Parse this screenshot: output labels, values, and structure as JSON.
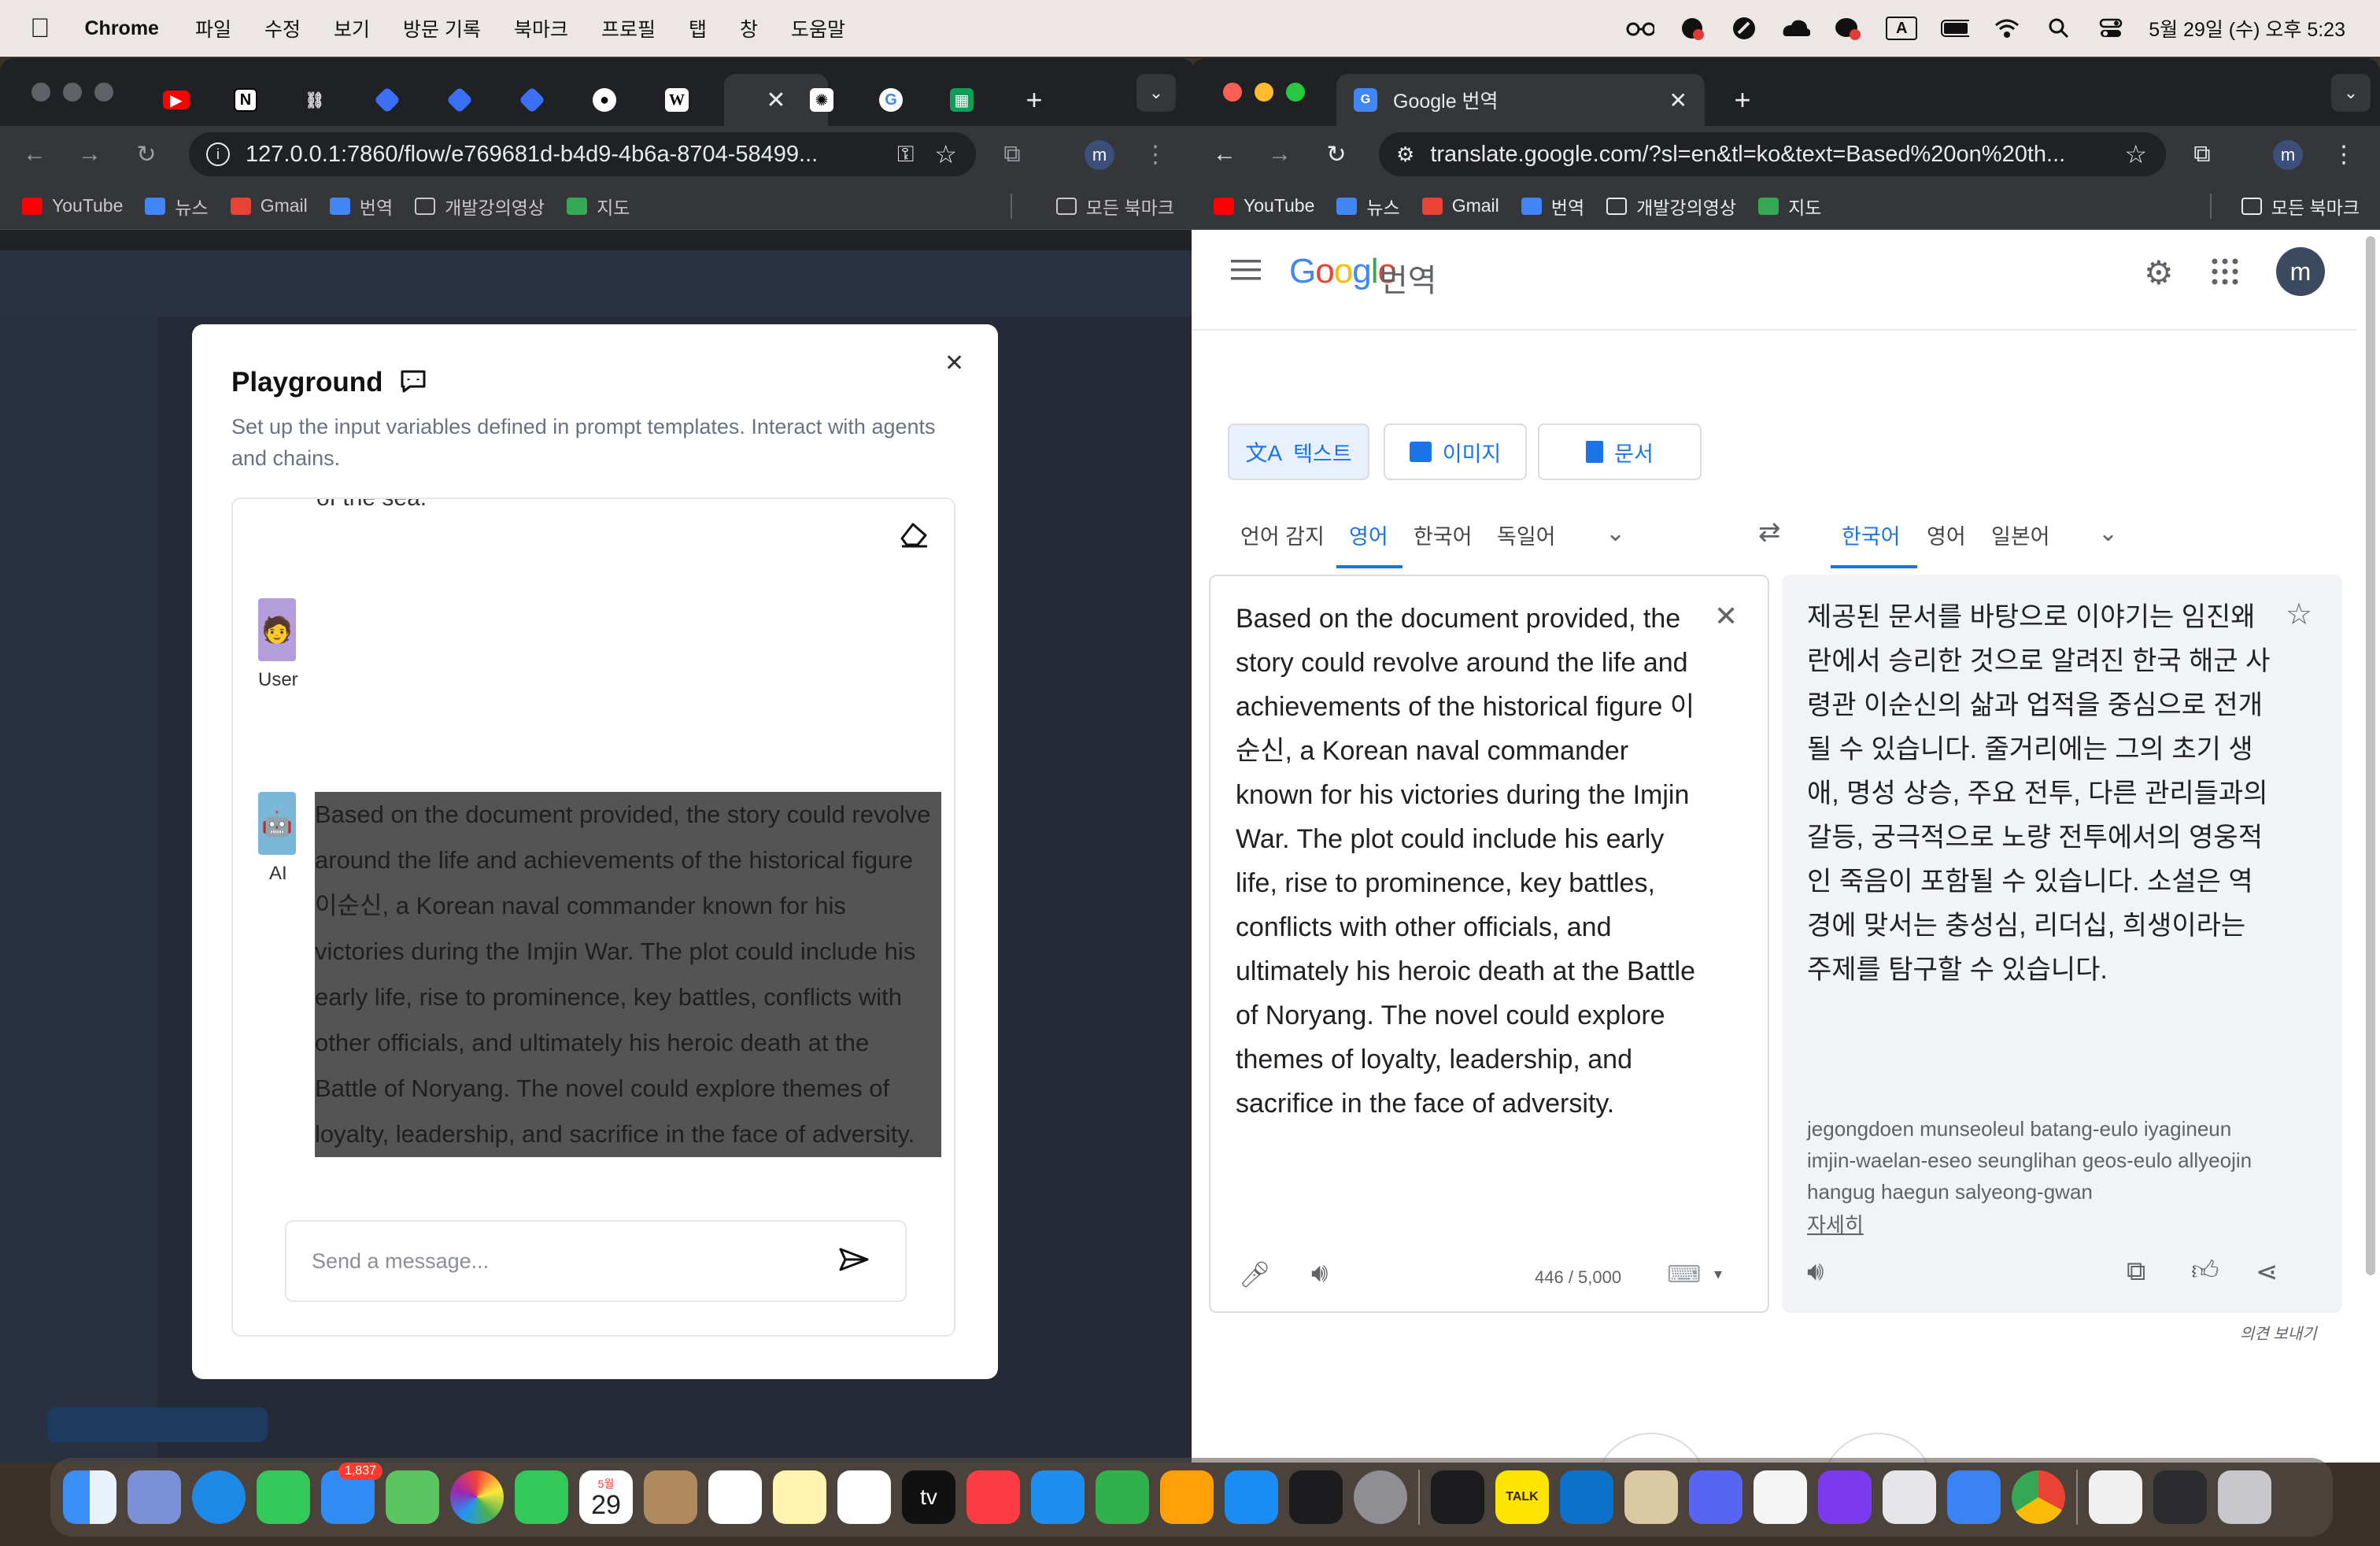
{
  "menubar": {
    "app": "Chrome",
    "items": [
      "파일",
      "수정",
      "보기",
      "방문 기록",
      "북마크",
      "프로필",
      "탭",
      "창",
      "도움말"
    ],
    "clock": "5월 29일 (수) 오후 5:23",
    "input_indicator": "A"
  },
  "left_window": {
    "url": "127.0.0.1:7860/flow/e769681d-b4d9-4b6a-8704-58499...",
    "profile_initial": "m",
    "bookmarks": [
      "YouTube",
      "뉴스",
      "Gmail",
      "번역",
      "개발강의영상",
      "지도"
    ],
    "all_bookmarks": "모든 북마크",
    "playground": {
      "title": "Playground",
      "description": "Set up the input variables defined in prompt templates. Interact with agents and chains.",
      "cut_text": "of the sea.",
      "user_label": "User",
      "ai_label": "AI",
      "ai_message": "Based on the document provided, the story could revolve around the life and achievements of the historical figure 이순신, a Korean naval commander known for his victories during the Imjin War. The plot could include his early life, rise to prominence, key battles, conflicts with other officials, and ultimately his heroic death at the Battle of Noryang. The novel could explore themes of loyalty, leadership, and sacrifice in the face of adversity.",
      "input_placeholder": "Send a message..."
    }
  },
  "right_window": {
    "tab_title": "Google 번역",
    "url": "translate.google.com/?sl=en&tl=ko&text=Based%20on%20th...",
    "profile_initial": "m",
    "bookmarks": [
      "YouTube",
      "뉴스",
      "Gmail",
      "번역",
      "개발강의영상",
      "지도"
    ],
    "all_bookmarks": "모든 북마크",
    "translate": {
      "product": "번역",
      "account_initial": "m",
      "modes": [
        "텍스트",
        "이미지",
        "문서"
      ],
      "source_langs": [
        "언어 감지",
        "영어",
        "한국어",
        "독일어"
      ],
      "target_langs": [
        "한국어",
        "영어",
        "일본어"
      ],
      "source_text": "Based on the document provided, the story could revolve around the life and achievements of the historical figure 이순신, a Korean naval commander known for his victories during the Imjin War. The plot could include his early life, rise to prominence, key battles, conflicts with other officials, and ultimately his heroic death at the Battle of Noryang. The novel could explore themes of loyalty, leadership, and sacrifice in the face of adversity.",
      "char_count": "446 / 5,000",
      "translated_text": "제공된 문서를 바탕으로 이야기는 임진왜란에서 승리한 것으로 알려진 한국 해군 사령관 이순신의 삶과 업적을 중심으로 전개될 수 있습니다. 줄거리에는 그의 초기 생애, 명성 상승, 주요 전투, 다른 관리들과의 갈등, 궁극적으로 노량 전투에서의 영웅적인 죽음이 포함될 수 있습니다. 소설은 역경에 맞서는 충성심, 리더십, 희생이라는 주제를 탐구할 수 있습니다.",
      "romanization": "jegongdoen munseoleul batang-eulo iyagineun imjin-waelan-eseo seunglihan geos-eulo allyeojin hangug haegun salyeong-gwan",
      "more_link": "자세히",
      "feedback": "의견 보내기"
    }
  },
  "dock": {
    "mail_badge": "1,837",
    "calendar_month": "5월",
    "calendar_day": "29",
    "tv_label": "tv",
    "talk_label": "TALK"
  }
}
